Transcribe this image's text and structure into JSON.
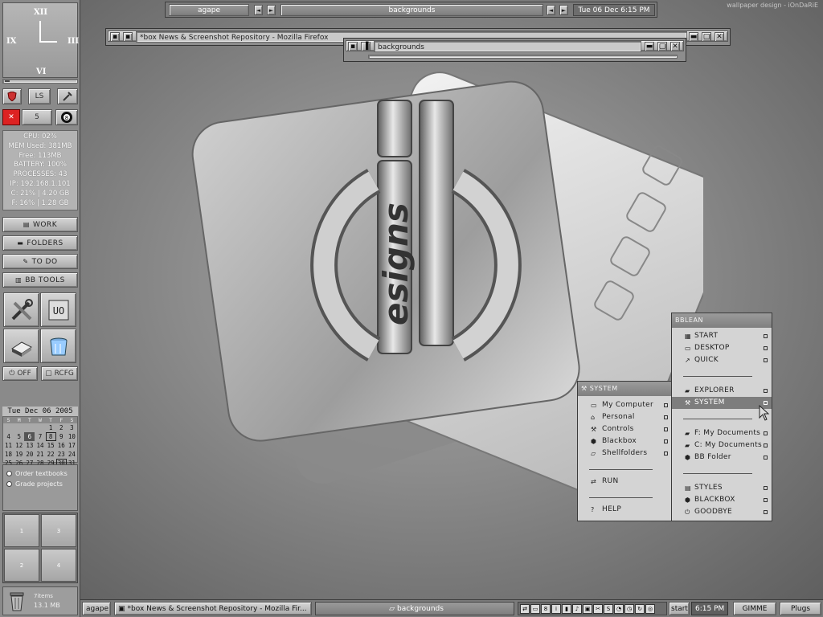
{
  "wallpaper_credit": "wallpaper design - iOnDaRiE",
  "clock": {
    "numerals": [
      "XII",
      "III",
      "VI",
      "IX"
    ]
  },
  "slit": {
    "buttons_row1": [
      "LS"
    ],
    "buttons_row2": [
      "5"
    ],
    "sysinfo": [
      "CPU: 02%",
      "MEM Used: 381MB",
      "Free: 113MB",
      "BATTERY: 100%",
      "PROCESSES: 43",
      "IP: 192.168.1.101",
      "C: 21% | 4.20 GB",
      "F: 16% | 1.28 GB"
    ],
    "nav": [
      "WORK",
      "FOLDERS",
      "TO DO",
      "BB TOOLS"
    ],
    "power": {
      "off": "OFF",
      "rcfg": "RCFG"
    },
    "date": "Tue Dec 06 2005",
    "weekdays": [
      "S",
      "M",
      "T",
      "W",
      "T",
      "F",
      "S"
    ],
    "todo": [
      "Order textbooks",
      "Grade projects"
    ],
    "desktops": [
      "1",
      "3",
      "2",
      "4"
    ],
    "trash": {
      "items": "7items",
      "size": "13.1 MB"
    }
  },
  "topbar": {
    "workspace": "agape",
    "window": "backgrounds",
    "clock": "Tue 06 Dec 6:15 PM"
  },
  "firefox_window": {
    "title": "*box News & Screenshot Repository - Mozilla Firefox"
  },
  "backgrounds_window": {
    "title": "backgrounds"
  },
  "logo_text": "esigns",
  "bblean_menu": {
    "title": "BBLEAN",
    "groups": [
      [
        {
          "label": "START",
          "icon": "start-icon"
        },
        {
          "label": "DESKTOP",
          "icon": "desktop-icon"
        },
        {
          "label": "QUICK",
          "icon": "quick-icon"
        }
      ],
      [
        {
          "label": "EXPLORER",
          "icon": "folder-icon"
        },
        {
          "label": "SYSTEM",
          "icon": "tools-icon",
          "selected": true
        }
      ],
      [
        {
          "label": "F: My Documents",
          "icon": "folder-icon"
        },
        {
          "label": "C: My Documents",
          "icon": "folder-icon"
        },
        {
          "label": "BB Folder",
          "icon": "bb-icon"
        }
      ],
      [
        {
          "label": "STYLES",
          "icon": "styles-icon"
        },
        {
          "label": "BLACKBOX",
          "icon": "bb-icon"
        },
        {
          "label": "GOODBYE",
          "icon": "power-icon"
        }
      ]
    ]
  },
  "system_menu": {
    "title": "SYSTEM",
    "items": [
      "My Computer",
      "Personal",
      "Controls",
      "Blackbox",
      "Shellfolders"
    ],
    "run": "RUN",
    "help": "HELP"
  },
  "taskbar": {
    "workspace": "agape",
    "task1": "*box News & Screenshot Repository - Mozilla Fir...",
    "task2": "backgrounds",
    "start": "start",
    "time": "6:15 PM",
    "gimme": "GIMME",
    "plugs": "Plugs"
  }
}
